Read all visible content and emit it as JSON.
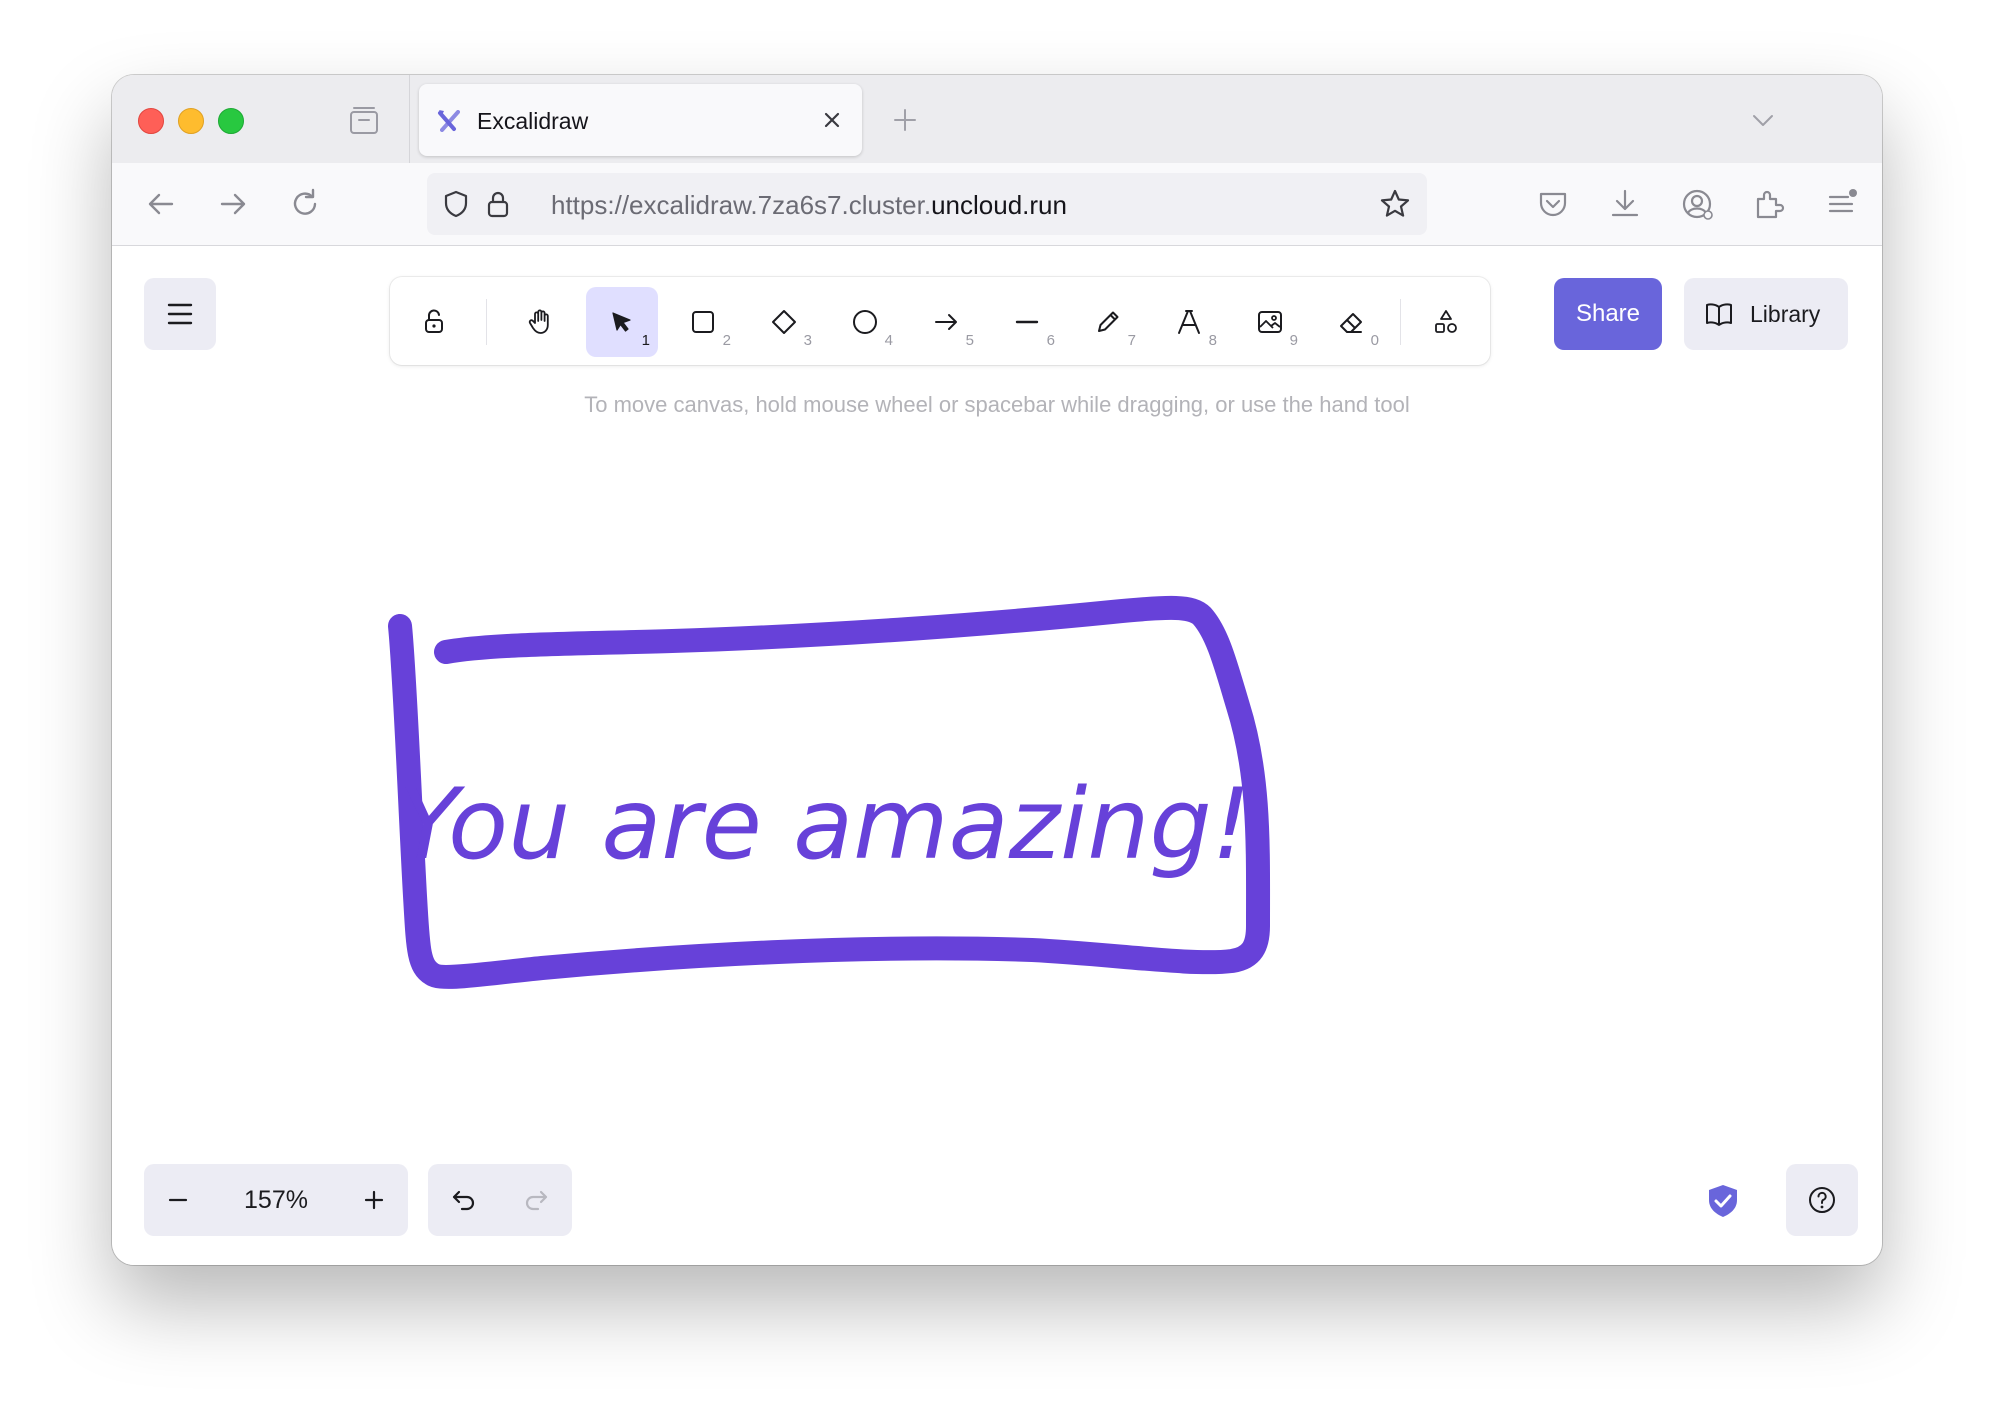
{
  "browser": {
    "tab_title": "Excalidraw",
    "url_prefix": "https://excalidraw.7za6s7.cluster.",
    "url_domain": "uncloud.run"
  },
  "toolbar": {
    "tools": [
      {
        "name": "lock-tool",
        "icon": "lock-icon",
        "key": ""
      },
      {
        "name": "hand-tool",
        "icon": "hand-icon",
        "key": ""
      },
      {
        "name": "selection-tool",
        "icon": "pointer-icon",
        "key": "1",
        "active": true
      },
      {
        "name": "rectangle-tool",
        "icon": "rectangle-icon",
        "key": "2"
      },
      {
        "name": "diamond-tool",
        "icon": "diamond-icon",
        "key": "3"
      },
      {
        "name": "ellipse-tool",
        "icon": "ellipse-icon",
        "key": "4"
      },
      {
        "name": "arrow-tool",
        "icon": "arrow-icon",
        "key": "5"
      },
      {
        "name": "line-tool",
        "icon": "line-icon",
        "key": "6"
      },
      {
        "name": "draw-tool",
        "icon": "pencil-icon",
        "key": "7"
      },
      {
        "name": "text-tool",
        "icon": "text-icon",
        "key": "8"
      },
      {
        "name": "image-tool",
        "icon": "image-icon",
        "key": "9"
      },
      {
        "name": "eraser-tool",
        "icon": "eraser-icon",
        "key": "0"
      },
      {
        "name": "more-shapes-tool",
        "icon": "shapes-icon",
        "key": ""
      }
    ],
    "share_label": "Share",
    "library_label": "Library"
  },
  "canvas": {
    "hint": "To move canvas, hold mouse wheel or spacebar while dragging, or use the hand tool",
    "drawing_text": "You are amazing!",
    "stroke_color": "#6741d9"
  },
  "footer": {
    "zoom_label": "157%"
  },
  "colors": {
    "accent": "#6965db",
    "active_tool_bg": "#e0dfff",
    "island_bg": "#ececf4"
  }
}
